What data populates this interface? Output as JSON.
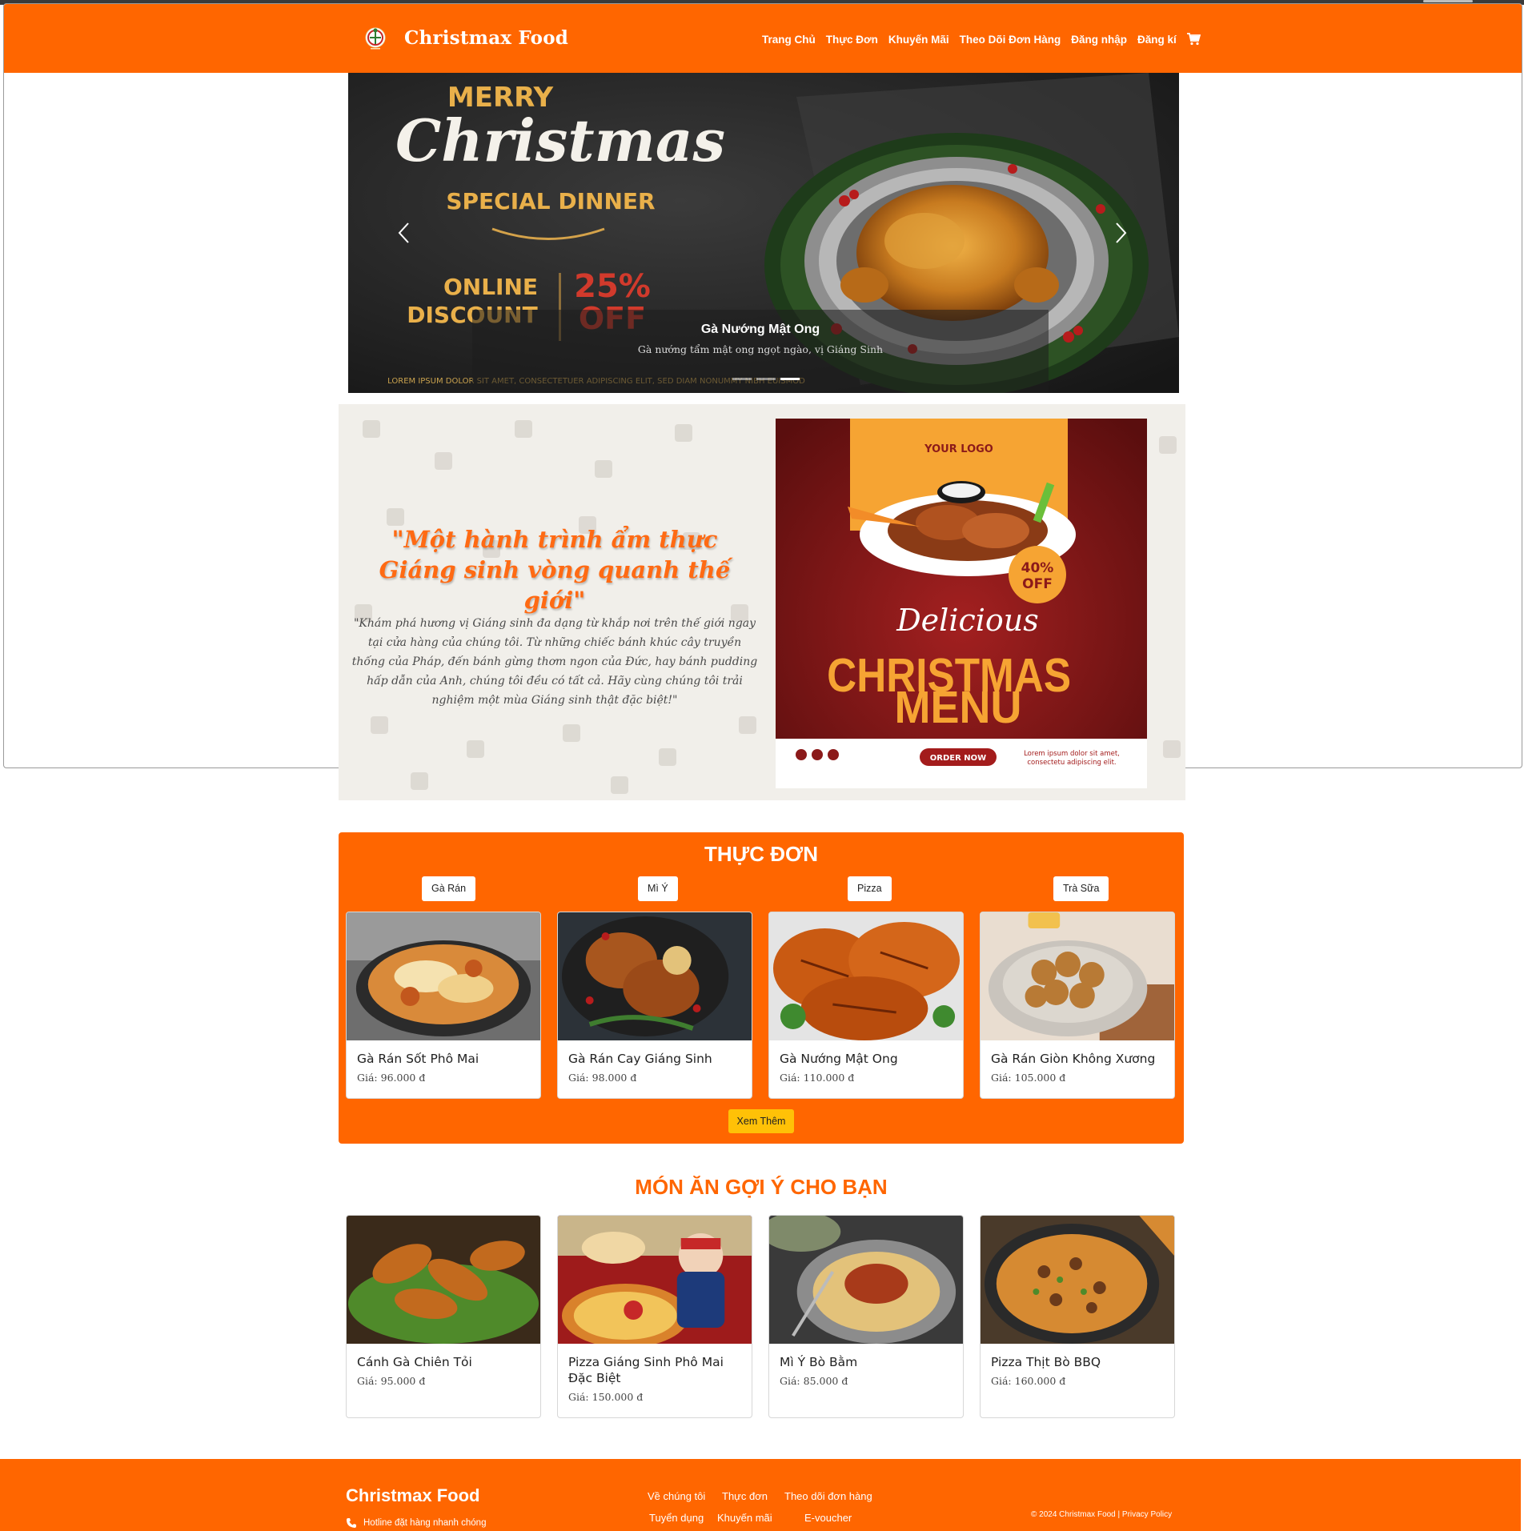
{
  "brand": {
    "name": "Christmax Food"
  },
  "nav": {
    "items": [
      "Trang Chủ",
      "Thực Đơn",
      "Khuyến Mãi",
      "Theo Dõi Đơn Hàng",
      "Đăng nhập",
      "Đăng kí"
    ],
    "cart_icon": "cart-icon"
  },
  "hero": {
    "caption_title": "Gà Nướng Mật Ong",
    "caption_desc": "Gà nướng tẩm mật ong ngọt ngào, vị Giáng Sinh",
    "banner": {
      "merry": "MERRY",
      "christmas": "Christmas",
      "special": "SPECIAL DINNER",
      "online": "ONLINE",
      "discount": "DISCOUNT",
      "percent": "25%",
      "off": "OFF",
      "lorem": "LOREM IPSUM DOLOR SIT AMET, CONSECTETUER ADIPISCING ELIT, SED DIAM NONUMMY NIBH EUISMOD"
    },
    "slide_count": 3,
    "active_slide": 3
  },
  "intro": {
    "quote": "\"Một hành trình ẩm thực Giáng sinh vòng quanh thế giới\"",
    "text": "\"Khám phá hương vị Giáng sinh đa dạng từ khắp nơi trên thế giới ngay tại cửa hàng của chúng tôi. Từ những chiếc bánh khúc cây truyền thống của Pháp, đến bánh gừng thơm ngon của Đức, hay bánh pudding hấp dẫn của Anh, chúng tôi đều có tất cả. Hãy cùng chúng tôi trải nghiệm một mùa Giáng sinh thật đặc biệt!\"",
    "poster": {
      "logo": "YOUR LOGO",
      "badge_pct": "40%",
      "badge_off": "OFF",
      "delicious": "Delicious",
      "christmas": "CHRISTMAS",
      "menu": "MENU",
      "order": "ORDER NOW",
      "lorem1": "Lorem ipsum dolor sit amet,",
      "lorem2": "consectetu adipiscing elit."
    }
  },
  "menu": {
    "title": "THỰC ĐƠN",
    "filters": [
      "Gà Rán",
      "Mì Ý",
      "Pizza",
      "Trà Sữa"
    ],
    "items": [
      {
        "name": "Gà Rán Sốt Phô Mai",
        "price": "Giá: 96.000 đ"
      },
      {
        "name": "Gà Rán Cay Giáng Sinh",
        "price": "Giá: 98.000 đ"
      },
      {
        "name": "Gà Nướng Mật Ong",
        "price": "Giá: 110.000 đ"
      },
      {
        "name": "Gà Rán Giòn Không Xương",
        "price": "Giá: 105.000 đ"
      }
    ],
    "more_label": "Xem Thêm"
  },
  "suggest": {
    "title": "MÓN ĂN GỢI Ý CHO BẠN",
    "items": [
      {
        "name": "Cánh Gà Chiên Tỏi",
        "price": "Giá: 95.000 đ"
      },
      {
        "name": "Pizza Giáng Sinh Phô Mai Đặc Biệt",
        "price": "Giá: 150.000 đ"
      },
      {
        "name": "Mì Ý Bò Bằm",
        "price": "Giá: 85.000 đ"
      },
      {
        "name": "Pizza Thịt Bò BBQ",
        "price": "Giá: 160.000 đ"
      }
    ]
  },
  "footer": {
    "brand": "Christmax Food",
    "hotline": "Hotline đặt hàng nhanh chóng",
    "links": [
      "Về chúng tôi",
      "Thực đơn",
      "Theo dõi đơn hàng",
      "Tuyển dụng",
      "Khuyến mãi",
      "E-voucher"
    ],
    "copyright": "© 2024 Christmax Food | Privacy Policy"
  },
  "colors": {
    "brand_orange": "#ff6600",
    "button_yellow": "#ffc107"
  }
}
